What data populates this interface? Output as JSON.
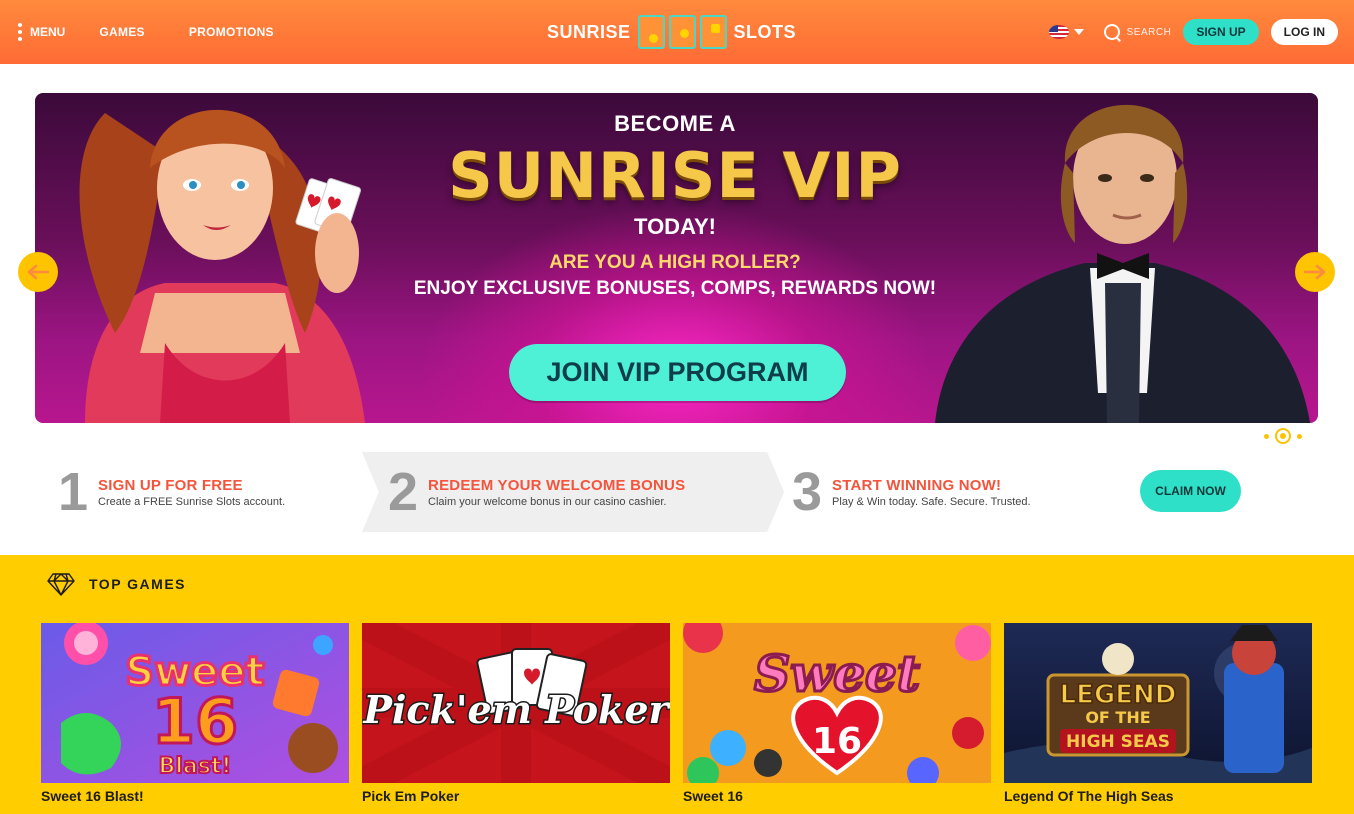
{
  "header": {
    "menu_label": "MENU",
    "nav": [
      "GAMES",
      "PROMOTIONS"
    ],
    "logo_left": "SUNRISE",
    "logo_right": "SLOTS",
    "search_label": "SEARCH",
    "signup_label": "SIGN UP",
    "login_label": "LOG IN",
    "accent": "#ff6b35",
    "teal": "#2ee0c7"
  },
  "hero": {
    "line1": "BECOME A",
    "title": "SUNRISE VIP",
    "line2": "TODAY!",
    "line3": "ARE YOU A HIGH ROLLER?",
    "line4": "ENJOY EXCLUSIVE BONUSES, COMPS, REWARDS NOW!",
    "cta": "JOIN VIP PROGRAM"
  },
  "steps": [
    {
      "num": "1",
      "title": "SIGN UP FOR FREE",
      "desc": "Create a FREE Sunrise Slots account."
    },
    {
      "num": "2",
      "title": "REDEEM YOUR WELCOME BONUS",
      "desc": "Claim your welcome bonus in our casino cashier."
    },
    {
      "num": "3",
      "title": "START WINNING NOW!",
      "desc": "Play & Win today. Safe. Secure. Trusted."
    }
  ],
  "claim_label": "CLAIM NOW",
  "games": {
    "heading": "TOP GAMES",
    "items": [
      {
        "name": "Sweet 16 Blast!",
        "art1": "Sweet",
        "art2": "16",
        "art3": "Blast!"
      },
      {
        "name": "Pick Em Poker",
        "art1": "Pick'em Poker"
      },
      {
        "name": "Sweet 16",
        "art1": "Sweet",
        "art2": "16"
      },
      {
        "name": "Legend Of The High Seas",
        "art1": "LEGEND",
        "art2": "OF THE",
        "art3": "HIGH SEAS"
      }
    ]
  }
}
